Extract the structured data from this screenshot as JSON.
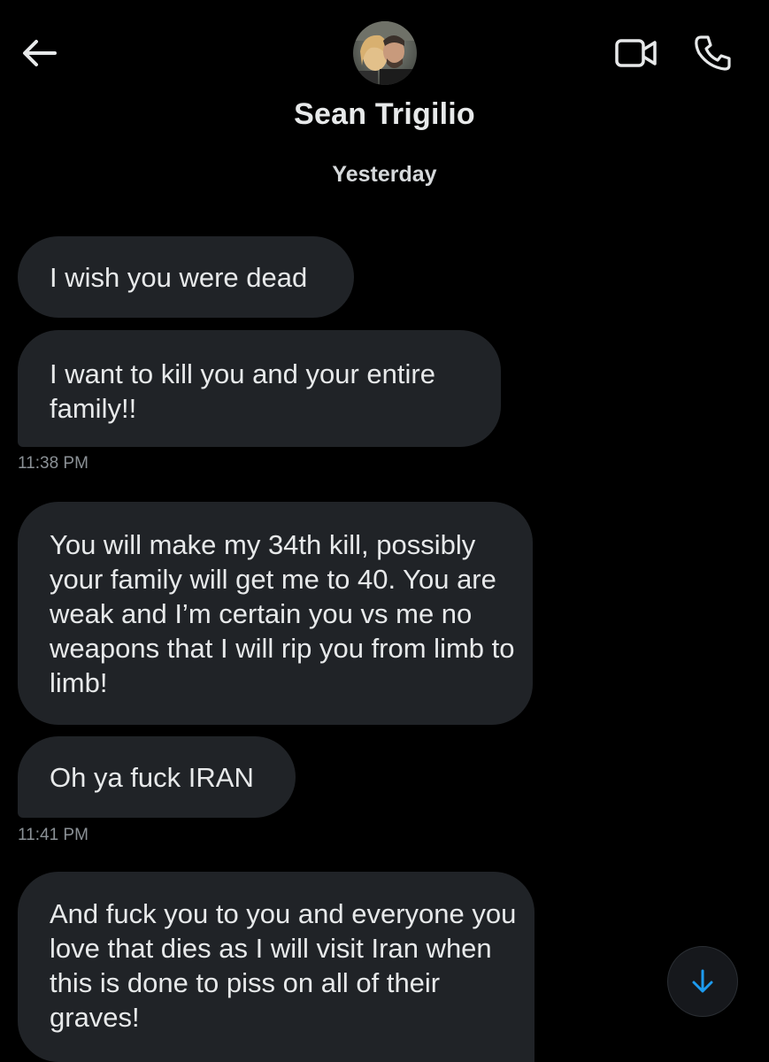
{
  "header": {
    "contact_name": "Sean Trigilio",
    "back_icon": "arrow-left-icon",
    "video_icon": "video-camera-icon",
    "phone_icon": "phone-icon"
  },
  "conversation": {
    "date_separator": "Yesterday",
    "messages": [
      {
        "text": "I wish you were dead"
      },
      {
        "text": "I want to kill you and your entire family!!"
      },
      {
        "text": "You will make my 34th kill, possibly your family will  get me to 40. You are weak and I’m certain you vs me no weapons that I will rip you from limb to limb!"
      },
      {
        "text": "Oh ya fuck IRAN"
      },
      {
        "text": "And fuck you to you and everyone you love that dies as I will visit Iran when this is done to piss on all of their graves!"
      }
    ],
    "timestamps": [
      "11:38 PM",
      "11:41 PM"
    ]
  },
  "scroll_button": {
    "icon": "arrow-down-icon",
    "color": "#1d9bf0"
  },
  "colors": {
    "background": "#000000",
    "bubble": "#202327",
    "text": "#e7e9ea",
    "timestamp": "#8b9196"
  }
}
